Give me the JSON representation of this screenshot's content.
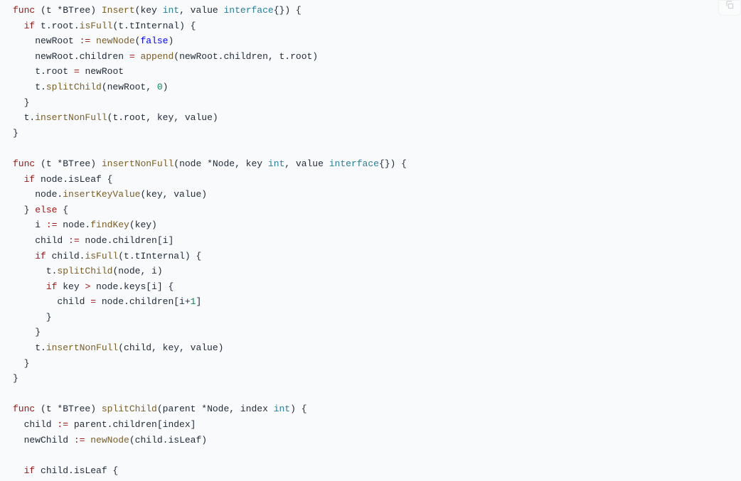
{
  "icons": {
    "copy": "copy-icon"
  },
  "code": {
    "tokens": [
      [
        [
          "k",
          "func"
        ],
        [
          "p",
          " (t *BTree) "
        ],
        [
          "fn",
          "Insert"
        ],
        [
          "p",
          "(key "
        ],
        [
          "typ",
          "int"
        ],
        [
          "p",
          ", value "
        ],
        [
          "typ",
          "interface"
        ],
        [
          "p",
          "{}) {"
        ]
      ],
      [
        [
          "p",
          "  "
        ],
        [
          "k",
          "if"
        ],
        [
          "p",
          " t.root."
        ],
        [
          "fn",
          "isFull"
        ],
        [
          "p",
          "(t.tInternal) {"
        ]
      ],
      [
        [
          "p",
          "    newRoot "
        ],
        [
          "op",
          ":="
        ],
        [
          "p",
          " "
        ],
        [
          "fn",
          "newNode"
        ],
        [
          "p",
          "("
        ],
        [
          "bool",
          "false"
        ],
        [
          "p",
          ")"
        ]
      ],
      [
        [
          "p",
          "    newRoot.children "
        ],
        [
          "op",
          "="
        ],
        [
          "p",
          " "
        ],
        [
          "fn",
          "append"
        ],
        [
          "p",
          "(newRoot.children, t.root)"
        ]
      ],
      [
        [
          "p",
          "    t.root "
        ],
        [
          "op",
          "="
        ],
        [
          "p",
          " newRoot"
        ]
      ],
      [
        [
          "p",
          "    t."
        ],
        [
          "fn",
          "splitChild"
        ],
        [
          "p",
          "(newRoot, "
        ],
        [
          "num",
          "0"
        ],
        [
          "p",
          ")"
        ]
      ],
      [
        [
          "p",
          "  }"
        ]
      ],
      [
        [
          "p",
          "  t."
        ],
        [
          "fn",
          "insertNonFull"
        ],
        [
          "p",
          "(t.root, key, value)"
        ]
      ],
      [
        [
          "p",
          "}"
        ]
      ],
      [
        [
          "p",
          ""
        ]
      ],
      [
        [
          "k",
          "func"
        ],
        [
          "p",
          " (t *BTree) "
        ],
        [
          "fn",
          "insertNonFull"
        ],
        [
          "p",
          "(node *Node, key "
        ],
        [
          "typ",
          "int"
        ],
        [
          "p",
          ", value "
        ],
        [
          "typ",
          "interface"
        ],
        [
          "p",
          "{}) {"
        ]
      ],
      [
        [
          "p",
          "  "
        ],
        [
          "k",
          "if"
        ],
        [
          "p",
          " node.isLeaf {"
        ]
      ],
      [
        [
          "p",
          "    node."
        ],
        [
          "fn",
          "insertKeyValue"
        ],
        [
          "p",
          "(key, value)"
        ]
      ],
      [
        [
          "p",
          "  } "
        ],
        [
          "k",
          "else"
        ],
        [
          "p",
          " {"
        ]
      ],
      [
        [
          "p",
          "    i "
        ],
        [
          "op",
          ":="
        ],
        [
          "p",
          " node."
        ],
        [
          "fn",
          "findKey"
        ],
        [
          "p",
          "(key)"
        ]
      ],
      [
        [
          "p",
          "    child "
        ],
        [
          "op",
          ":="
        ],
        [
          "p",
          " node.children[i]"
        ]
      ],
      [
        [
          "p",
          "    "
        ],
        [
          "k",
          "if"
        ],
        [
          "p",
          " child."
        ],
        [
          "fn",
          "isFull"
        ],
        [
          "p",
          "(t.tInternal) {"
        ]
      ],
      [
        [
          "p",
          "      t."
        ],
        [
          "fn",
          "splitChild"
        ],
        [
          "p",
          "(node, i)"
        ]
      ],
      [
        [
          "p",
          "      "
        ],
        [
          "k",
          "if"
        ],
        [
          "p",
          " key "
        ],
        [
          "op",
          ">"
        ],
        [
          "p",
          " node.keys[i] {"
        ]
      ],
      [
        [
          "p",
          "        child "
        ],
        [
          "op",
          "="
        ],
        [
          "p",
          " node.children[i+"
        ],
        [
          "num",
          "1"
        ],
        [
          "p",
          "]"
        ]
      ],
      [
        [
          "p",
          "      }"
        ]
      ],
      [
        [
          "p",
          "    }"
        ]
      ],
      [
        [
          "p",
          "    t."
        ],
        [
          "fn",
          "insertNonFull"
        ],
        [
          "p",
          "(child, key, value)"
        ]
      ],
      [
        [
          "p",
          "  }"
        ]
      ],
      [
        [
          "p",
          "}"
        ]
      ],
      [
        [
          "p",
          ""
        ]
      ],
      [
        [
          "k",
          "func"
        ],
        [
          "p",
          " (t *BTree) "
        ],
        [
          "fn",
          "splitChild"
        ],
        [
          "p",
          "(parent *Node, index "
        ],
        [
          "typ",
          "int"
        ],
        [
          "p",
          ") {"
        ]
      ],
      [
        [
          "p",
          "  child "
        ],
        [
          "op",
          ":="
        ],
        [
          "p",
          " parent.children[index]"
        ]
      ],
      [
        [
          "p",
          "  newChild "
        ],
        [
          "op",
          ":="
        ],
        [
          "p",
          " "
        ],
        [
          "fn",
          "newNode"
        ],
        [
          "p",
          "(child.isLeaf)"
        ]
      ],
      [
        [
          "p",
          ""
        ]
      ],
      [
        [
          "p",
          "  "
        ],
        [
          "k",
          "if"
        ],
        [
          "p",
          " child.isLeaf {"
        ]
      ]
    ]
  }
}
